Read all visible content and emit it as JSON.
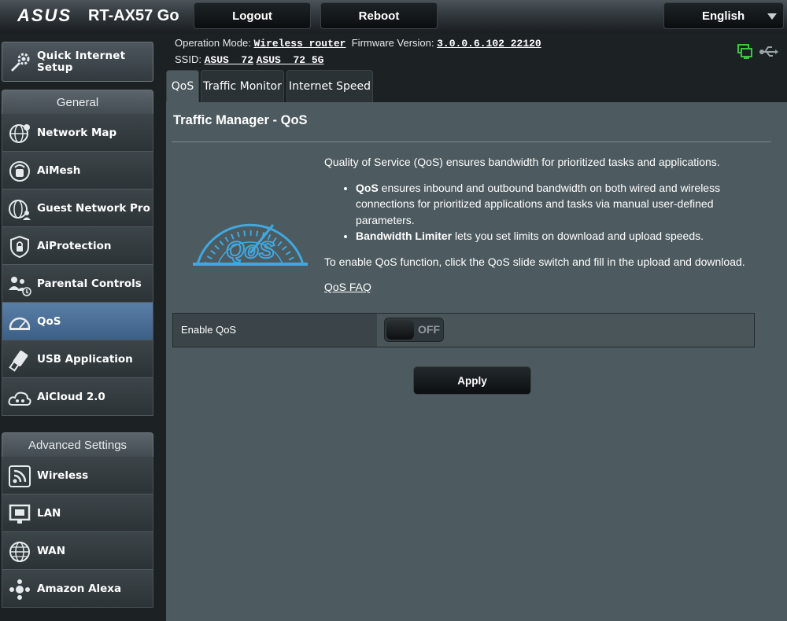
{
  "header": {
    "brand": "ASUS",
    "model": "RT-AX57 Go",
    "buttons": {
      "logout": "Logout",
      "reboot": "Reboot"
    },
    "language": "English"
  },
  "info": {
    "operation_mode_label": "Operation Mode:",
    "operation_mode_value": "Wireless router",
    "firmware_label": "Firmware Version:",
    "firmware_value": "3.0.0.6.102_22120",
    "ssid_label": "SSID:",
    "ssid_1": "ASUS _72",
    "ssid_2": "ASUS _72_5G"
  },
  "sidebar": {
    "quick_setup": "Quick Internet Setup",
    "general_header": "General",
    "general_items": [
      {
        "label": "Network Map",
        "icon": "network-map-icon"
      },
      {
        "label": "AiMesh",
        "icon": "aimesh-icon"
      },
      {
        "label": "Guest Network Pro",
        "icon": "guest-network-icon"
      },
      {
        "label": "AiProtection",
        "icon": "aiprotection-icon"
      },
      {
        "label": "Parental Controls",
        "icon": "parental-controls-icon"
      },
      {
        "label": "QoS",
        "icon": "qos-icon",
        "active": true
      },
      {
        "label": "USB Application",
        "icon": "usb-icon"
      },
      {
        "label": "AiCloud 2.0",
        "icon": "aicloud-icon"
      }
    ],
    "advanced_header": "Advanced Settings",
    "advanced_items": [
      {
        "label": "Wireless",
        "icon": "wireless-icon"
      },
      {
        "label": "LAN",
        "icon": "lan-icon"
      },
      {
        "label": "WAN",
        "icon": "wan-icon"
      },
      {
        "label": "Amazon Alexa",
        "icon": "alexa-icon"
      }
    ]
  },
  "tabs": [
    {
      "label": "QoS",
      "active": true
    },
    {
      "label": "Traffic Monitor"
    },
    {
      "label": "Internet Speed"
    }
  ],
  "main": {
    "title": "Traffic Manager - QoS",
    "intro": "Quality of Service (QoS) ensures bandwidth for prioritized tasks and applications.",
    "bullets": [
      {
        "bold": "QoS",
        "text": " ensures inbound and outbound bandwidth on both wired and wireless connections for prioritized applications and tasks via manual user-defined parameters."
      },
      {
        "bold": "Bandwidth Limiter",
        "text": " lets you set limits on download and upload speeds."
      }
    ],
    "enable_hint": "To enable QoS function, click the QoS slide switch and fill in the upload and download.",
    "faq_link": "QoS FAQ",
    "enable_label": "Enable QoS",
    "toggle_state": "OFF",
    "apply_label": "Apply",
    "gauge_text": "QoS"
  },
  "colors": {
    "accent_blue": "#3fa8e0",
    "active_menu": "#4a6f96",
    "panel_bg": "#4d5a5f",
    "status_green": "#3ec43e"
  }
}
